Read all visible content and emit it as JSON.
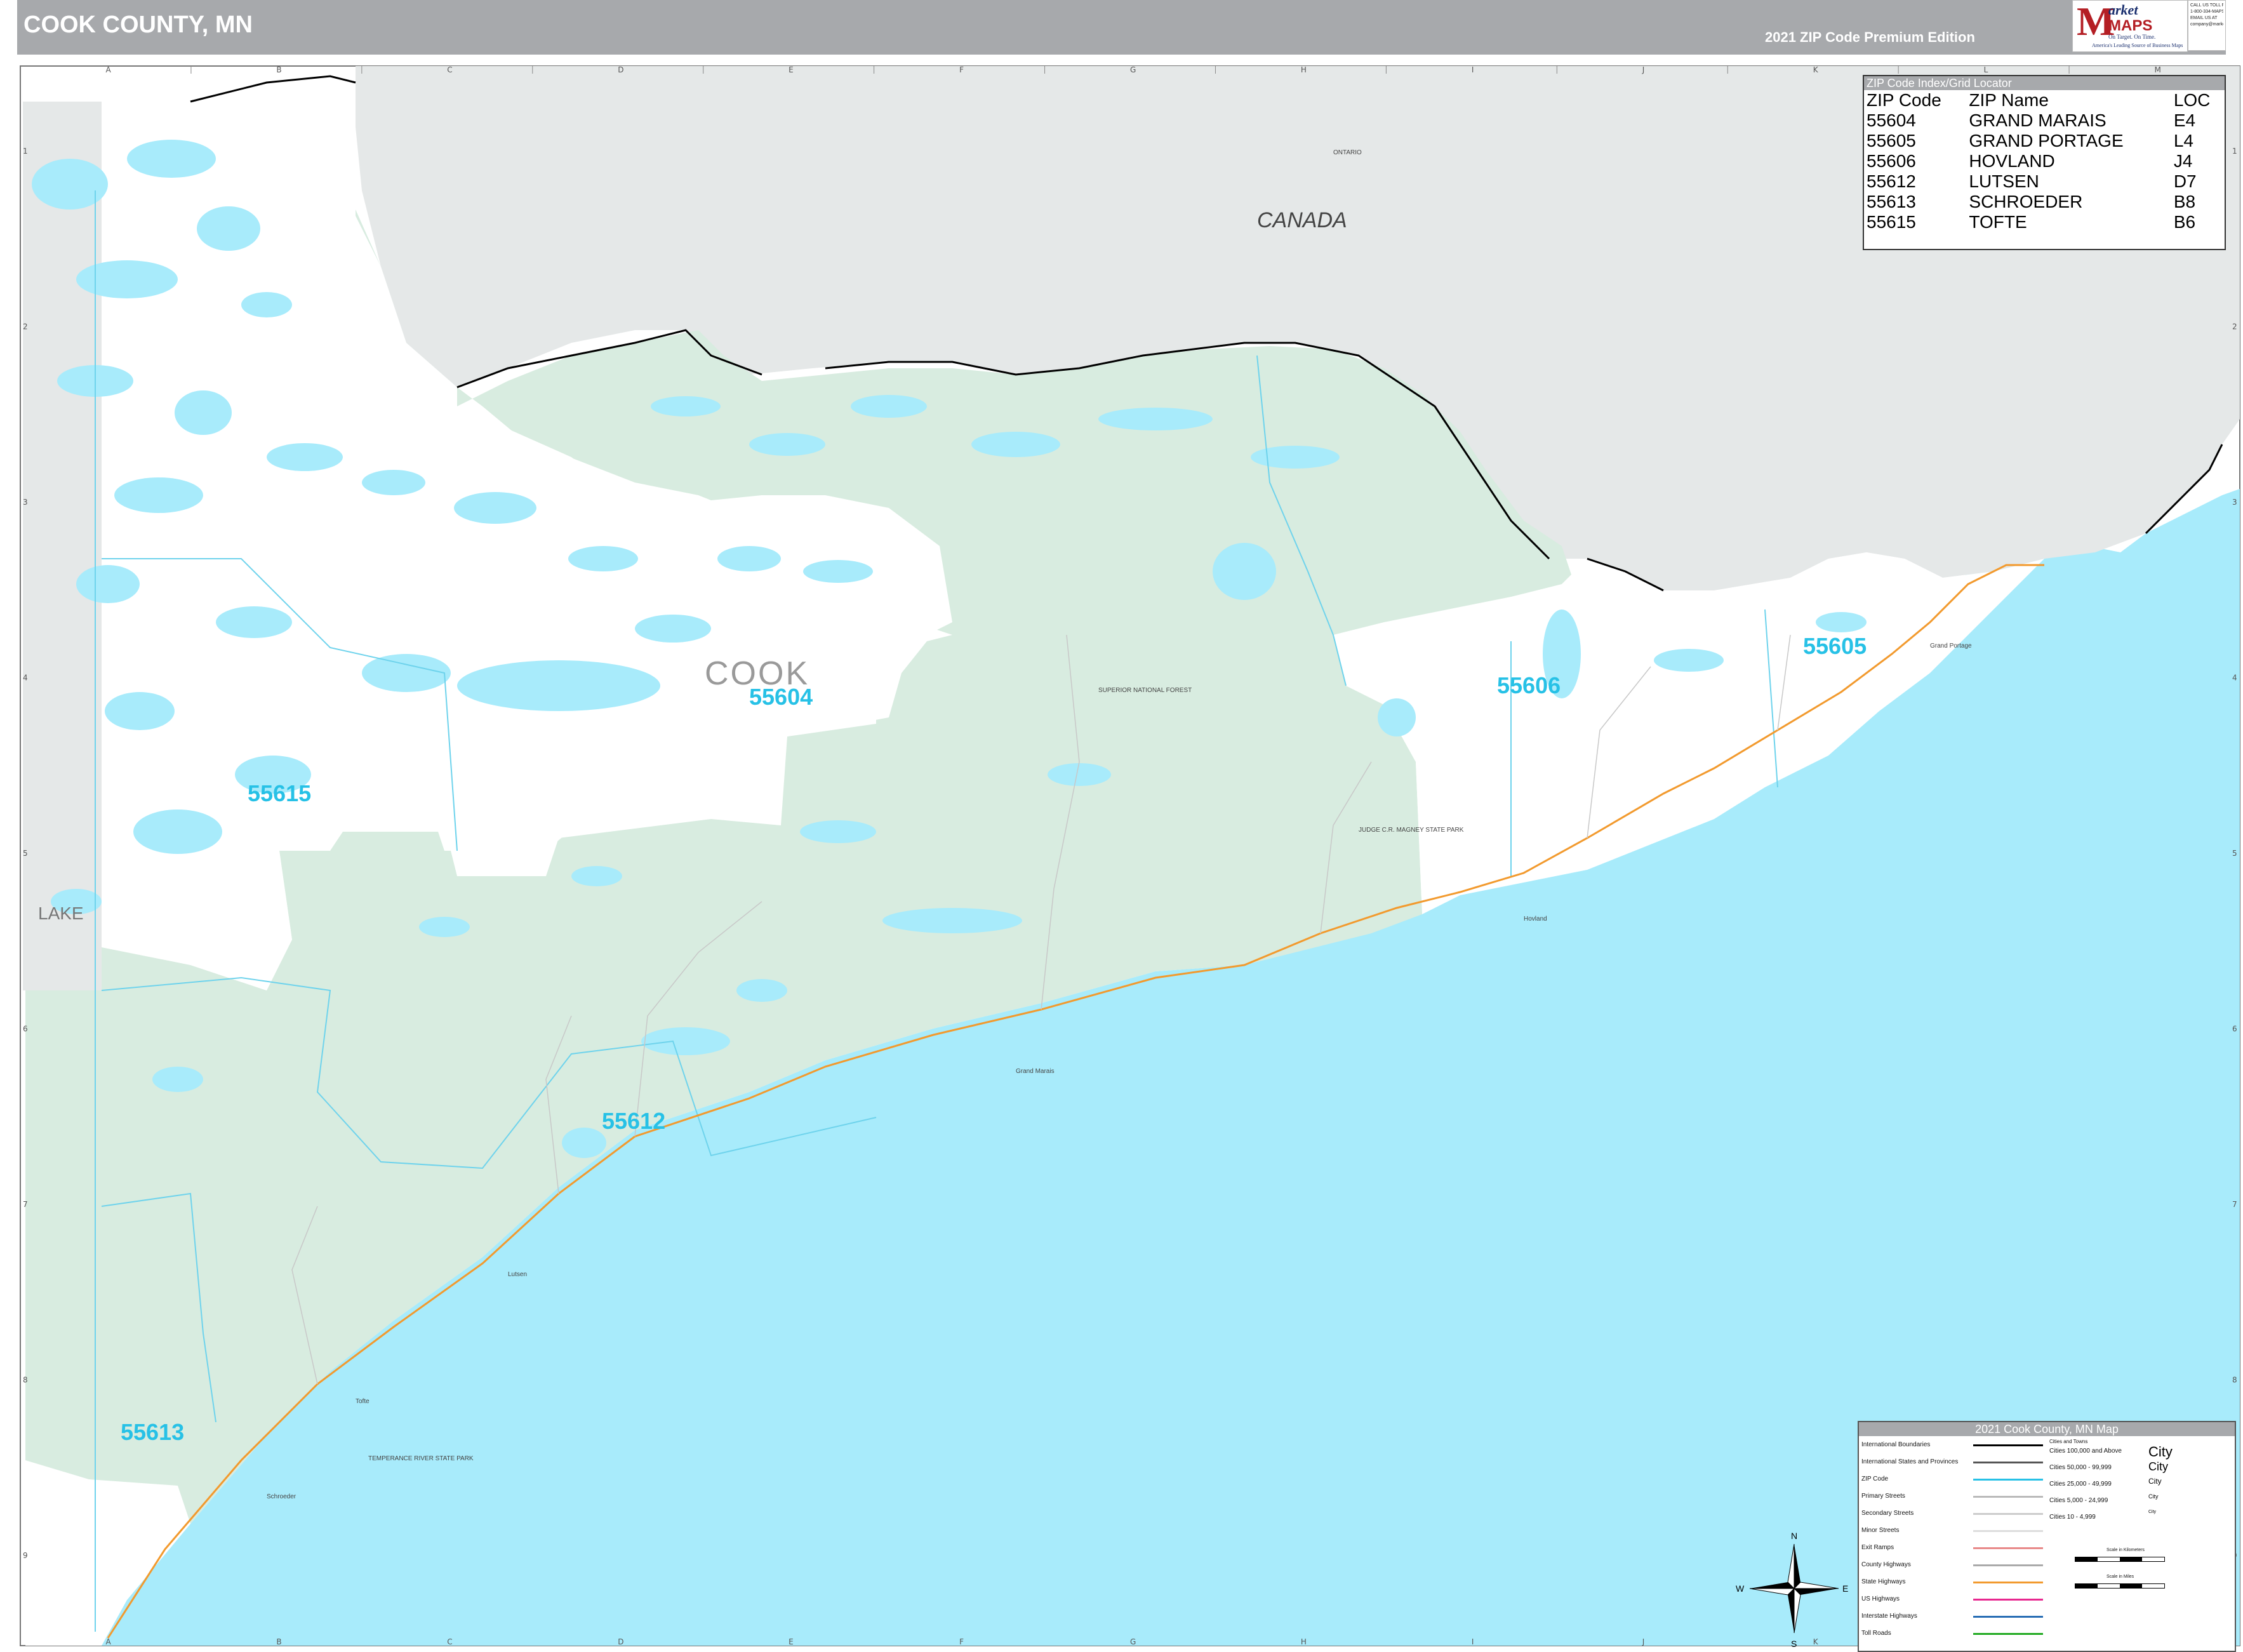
{
  "header": {
    "title": "COOK COUNTY, MN",
    "edition": "2021 ZIP Code Premium Edition",
    "logo": {
      "top_word": "arket",
      "letter": "M",
      "brand": "MAPS",
      "tagline": "On Target.  On Time.",
      "tagline2": "America's Leading Source of Business Maps",
      "contact": [
        "CALL US TOLL FREE",
        "1-800-334-MAPS",
        "EMAIL US AT",
        "company@marketmaps.com"
      ]
    }
  },
  "grid": {
    "columns": [
      "A",
      "B",
      "C",
      "D",
      "E",
      "F",
      "G",
      "H",
      "I",
      "J",
      "K",
      "L",
      "M"
    ],
    "rows": [
      "1",
      "2",
      "3",
      "4",
      "5",
      "6",
      "7",
      "8",
      "9"
    ]
  },
  "map": {
    "places": {
      "canada": "CANADA",
      "ontario": "ONTARIO",
      "county": "COOK",
      "lake": "LAKE"
    },
    "zip_labels": [
      "55604",
      "55605",
      "55606",
      "55612",
      "55613",
      "55615"
    ],
    "small_labels": [
      "SUPERIOR NATIONAL FOREST",
      "JUDGE C.R. MAGNEY STATE PARK",
      "TEMPERANCE RIVER STATE PARK",
      "Grand Marais",
      "Lutsen",
      "Tofte",
      "Schroeder",
      "Hovland",
      "Grand Portage"
    ],
    "colors": {
      "water": "#a8ebfb",
      "canada": "#e5e8e8",
      "forest": "#d8ece0",
      "land": "#ffffff",
      "zip_line": "#6fd3ec",
      "highway": "#f29a2e"
    }
  },
  "zip_index": {
    "title": "ZIP Code Index/Grid Locator",
    "headers": [
      "ZIP Code",
      "ZIP Name",
      "LOC"
    ],
    "rows": [
      [
        "55604",
        "GRAND MARAIS",
        "E4"
      ],
      [
        "55605",
        "GRAND PORTAGE",
        "L4"
      ],
      [
        "55606",
        "HOVLAND",
        "J4"
      ],
      [
        "55612",
        "LUTSEN",
        "D7"
      ],
      [
        "55613",
        "SCHROEDER",
        "B8"
      ],
      [
        "55615",
        "TOFTE",
        "B6"
      ]
    ]
  },
  "legend": {
    "title": "2021 Cook County, MN Map",
    "items": [
      {
        "label": "International Boundaries",
        "color": "#000000"
      },
      {
        "label": "International States and Provinces",
        "color": "#555555"
      },
      {
        "label": "ZIP Code",
        "color": "#27c1e6"
      },
      {
        "label": "Primary Streets",
        "color": "#bbbbbb"
      },
      {
        "label": "Secondary Streets",
        "color": "#cccccc"
      },
      {
        "label": "Minor Streets",
        "color": "#dddddd"
      },
      {
        "label": "Exit Ramps",
        "color": "#e88a8a"
      },
      {
        "label": "County Highways",
        "color": "#aaaaaa"
      },
      {
        "label": "State Highways",
        "color": "#f29a2e"
      },
      {
        "label": "US Highways",
        "color": "#e8278f"
      },
      {
        "label": "Interstate Highways",
        "color": "#2a6fb5"
      },
      {
        "label": "Toll Roads",
        "color": "#22aa22"
      }
    ],
    "cities_header": "Cities and Towns",
    "cities": [
      {
        "label": "Cities 100,000 and Above",
        "sample": "City"
      },
      {
        "label": "Cities 50,000 - 99,999",
        "sample": "City"
      },
      {
        "label": "Cities 25,000 - 49,999",
        "sample": "City"
      },
      {
        "label": "Cities 5,000 - 24,999",
        "sample": "City"
      },
      {
        "label": "Cities 10 - 4,999",
        "sample": "City"
      }
    ],
    "scale_km": "Scale in Kilometers",
    "scale_mi": "Scale in Miles"
  },
  "compass": {
    "n": "N",
    "s": "S",
    "e": "E",
    "w": "W"
  }
}
